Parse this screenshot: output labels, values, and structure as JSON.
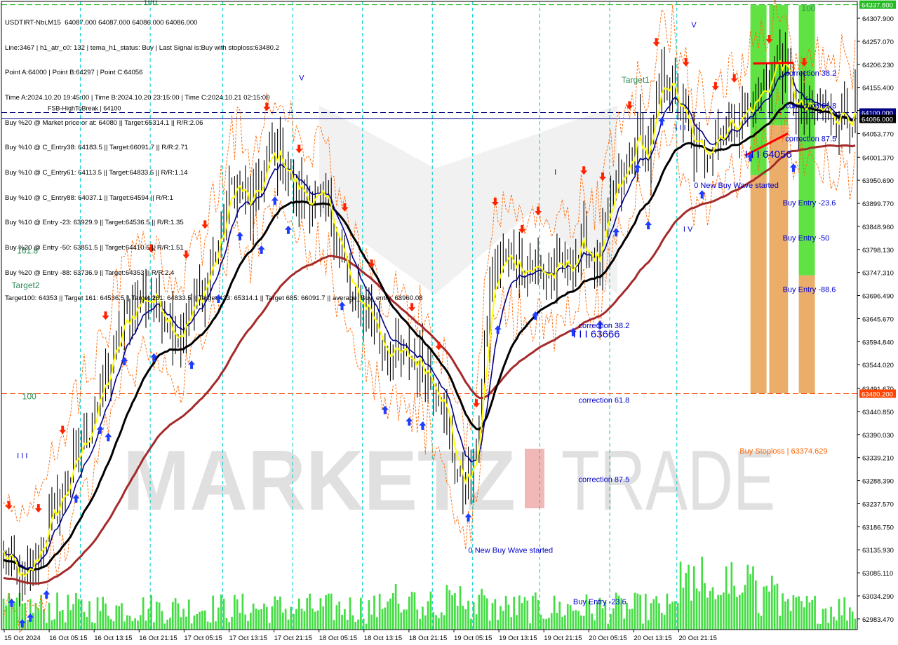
{
  "header": {
    "lines": [
      "USDTIRT-Nbi,M15  64087.000 64087.000 64086.000 64086.000",
      "Line:3467 | h1_atr_c0: 132 | tema_h1_status: Buy | Last Signal is:Buy with stoploss:63480.2",
      "Point A:64000 | Point B:64297 | Point C:64056",
      "Time A:2024.10.20 19:45:00 | Time B:2024.10.20 23:15:00 | Time C:2024.10.21 02:15:00",
      "Buy %20 @ Market price or at: 64080 || Target:65314.1 || R/R:2.06",
      "Buy %10 @ C_Entry38: 64183.5 || Target:66091.7 || R/R:2.71",
      "Buy %10 @ C_Entry61: 64113.5 || Target:64833.5 || R/R:1.14",
      "Buy %10 @ C_Entry88: 64037.1 || Target:64594 || R/R:1",
      "Buy %10 @ Entry -23: 63929.9 || Target:64536.5 || R/R:1.35",
      "Buy %20 @ Entry -50: 63851.5 || Target:64410.5 || R/R:1.51",
      "Buy %20 @ Entry -88: 63736.9 || Target:64353 || R/R:2.4",
      "Target100: 64353 || Target 161: 64536.5 || Target 261: 64833.5 || Target 423: 65314.1 || Target 685: 66091.7 || average_Buy_entry: 63960.08"
    ]
  },
  "watermark": {
    "left": "MARKETZ",
    "right": "TRADE"
  },
  "colors": {
    "bull_ma": "#ffff00",
    "blue_ma": "#00008b",
    "black_ma": "#000000",
    "red_ma": "#a52a2a",
    "volume": "#44dd44",
    "arrow_up": "#1e3cff",
    "arrow_down": "#ff2200",
    "green_zone": "#44dd22",
    "orange_zone": "#e8a050",
    "label_blue": "#0000cd",
    "label_green": "#2e8b57",
    "label_orange": "#ff6600",
    "grid": "#00cccc"
  },
  "chart_data": {
    "type": "candlestick",
    "symbol": "USDTIRT-Nbi,M15",
    "y_range": [
      62960,
      64345
    ],
    "y_ticks": [
      "64307.900",
      "64257.070",
      "64206.230",
      "64155.400",
      "64104.570",
      "64053.770",
      "64001.370",
      "63950.690",
      "63899.770",
      "63848.960",
      "63798.130",
      "63747.310",
      "63696.490",
      "63645.670",
      "63594.840",
      "63544.020",
      "63491.670",
      "63440.850",
      "63390.030",
      "63339.210",
      "63288.390",
      "63237.570",
      "63186.750",
      "63135.930",
      "63085.110",
      "63034.290",
      "62983.470"
    ],
    "x_ticks": [
      "15 Oct 2024",
      "16 Oct 05:15",
      "16 Oct 13:15",
      "16 Oct 21:15",
      "17 Oct 05:15",
      "17 Oct 13:15",
      "17 Oct 21:15",
      "18 Oct 05:15",
      "18 Oct 13:15",
      "18 Oct 21:15",
      "19 Oct 05:15",
      "19 Oct 13:15",
      "19 Oct 21:15",
      "20 Oct 05:15",
      "20 Oct 13:15",
      "20 Oct 21:15"
    ],
    "price_badges": [
      {
        "text": "64337.800",
        "bg": "#22bb22",
        "fg": "#ffffff",
        "value": 64337.8
      },
      {
        "text": "64100.000",
        "bg": "#000080",
        "fg": "#ffffff",
        "value": 64100
      },
      {
        "text": "64086.000",
        "bg": "#000000",
        "fg": "#ffffff",
        "value": 64086
      },
      {
        "text": "63480.200",
        "bg": "#ff4400",
        "fg": "#ffffff",
        "value": 63480.2
      }
    ],
    "hlines": [
      {
        "value": 64100,
        "label": "FSB-HighToBreak | 64100",
        "style": "dashed",
        "color": "#000080"
      },
      {
        "value": 64086,
        "label": "",
        "style": "solid",
        "color": "#000080"
      },
      {
        "value": 63480.2,
        "label": "",
        "style": "dashed",
        "color": "#ff4400"
      },
      {
        "value": 64337.8,
        "label": "",
        "style": "dashed",
        "color": "#22bb22"
      }
    ],
    "annotations": [
      {
        "text": "100",
        "color": "#2e8b57",
        "bar": 52,
        "value": 64337
      },
      {
        "text": "100",
        "color": "#2e8b57",
        "bar": 297,
        "value": 64323
      },
      {
        "text": "Target1",
        "color": "#2e8b57",
        "bar": 230,
        "value": 64166
      },
      {
        "text": "161.8",
        "color": "#2e8b57",
        "bar": 5,
        "value": 63789
      },
      {
        "text": "Target2",
        "color": "#2e8b57",
        "bar": 3,
        "value": 63713
      },
      {
        "text": "100",
        "color": "#2e8b57",
        "bar": 7,
        "value": 63468
      },
      {
        "text": "I I I",
        "color": "#0000cd",
        "bar": 5,
        "value": 63338
      },
      {
        "text": "I I I",
        "color": "#0000cd",
        "bar": 250,
        "value": 64061
      },
      {
        "text": "I",
        "color": "#0000cd",
        "bar": 205,
        "value": 63963
      },
      {
        "text": "V",
        "color": "#0000cd",
        "bar": 110,
        "value": 64171
      },
      {
        "text": "V",
        "color": "#0000cd",
        "bar": 256,
        "value": 64288
      },
      {
        "text": "I V",
        "color": "#0000cd",
        "bar": 253,
        "value": 63837
      },
      {
        "text": "correction 38.2",
        "color": "#0000cd",
        "bar": 214,
        "value": 63625
      },
      {
        "text": "I I I 63666",
        "color": "#0000cd",
        "bar": 212,
        "value": 63604
      },
      {
        "text": "correction 61.8",
        "color": "#0000cd",
        "bar": 214,
        "value": 63460
      },
      {
        "text": "correction 87.5",
        "color": "#0000cd",
        "bar": 214,
        "value": 63285
      },
      {
        "text": "0 New Buy Wave started",
        "color": "#0000cd",
        "bar": 173,
        "value": 63129
      },
      {
        "text": "Buy Entry -23.6",
        "color": "#0000cd",
        "bar": 212,
        "value": 63016
      },
      {
        "text": "correction 38.2",
        "color": "#0000cd",
        "bar": 291,
        "value": 64181
      },
      {
        "text": "correction 61.8",
        "color": "#0000cd",
        "bar": 291,
        "value": 64109
      },
      {
        "text": "correction 87.5",
        "color": "#0000cd",
        "bar": 291,
        "value": 64037
      },
      {
        "text": "I I I 64056",
        "color": "#0000cd",
        "bar": 276,
        "value": 64000
      },
      {
        "text": "0 New Buy Wave started",
        "color": "#0000cd",
        "bar": 257,
        "value": 63934
      },
      {
        "text": "Buy Entry -23.6",
        "color": "#0000cd",
        "bar": 290,
        "value": 63895
      },
      {
        "text": "Buy Entry -50",
        "color": "#0000cd",
        "bar": 290,
        "value": 63818
      },
      {
        "text": "Buy Entry -88.6",
        "color": "#0000cd",
        "bar": 290,
        "value": 63704
      },
      {
        "text": "Buy Stoploss | 63374.629",
        "color": "#ff6600",
        "bar": 274,
        "value": 63348
      }
    ],
    "zones": [
      {
        "bar_from": 278,
        "bar_to": 284,
        "y_top": 64337,
        "y_bottom": 63962,
        "color": "#44dd22"
      },
      {
        "bar_from": 285,
        "bar_to": 292,
        "y_top": 64337,
        "y_bottom": 64072,
        "color": "#44dd22"
      },
      {
        "bar_from": 296,
        "bar_to": 302,
        "y_top": 64337,
        "y_bottom": 63741,
        "color": "#44dd22"
      },
      {
        "bar_from": 278,
        "bar_to": 284,
        "y_top": 63962,
        "y_bottom": 63481,
        "color": "#e8a050"
      },
      {
        "bar_from": 285,
        "bar_to": 292,
        "y_top": 64072,
        "y_bottom": 63481,
        "color": "#e8a050"
      },
      {
        "bar_from": 296,
        "bar_to": 302,
        "y_top": 63741,
        "y_bottom": 63481,
        "color": "#e8a050"
      }
    ],
    "red_segments": [
      {
        "from": [
          279,
          64208
        ],
        "to": [
          294,
          64210
        ]
      },
      {
        "from": [
          276,
          64005
        ],
        "to": [
          292,
          64054
        ]
      }
    ],
    "arrows_up_bars": [
      3,
      7,
      10,
      16,
      27,
      36,
      39,
      45,
      56,
      70,
      80,
      88,
      96,
      101,
      106,
      126,
      142,
      151,
      156,
      173,
      184,
      198,
      212,
      222,
      228,
      236,
      240,
      245,
      260,
      278,
      294
    ],
    "arrows_down_bars": [
      2,
      13,
      22,
      38,
      55,
      68,
      75,
      98,
      110,
      127,
      137,
      152,
      162,
      176,
      183,
      193,
      199,
      216,
      223,
      233,
      243,
      254,
      265,
      272,
      285,
      288,
      298
    ]
  }
}
